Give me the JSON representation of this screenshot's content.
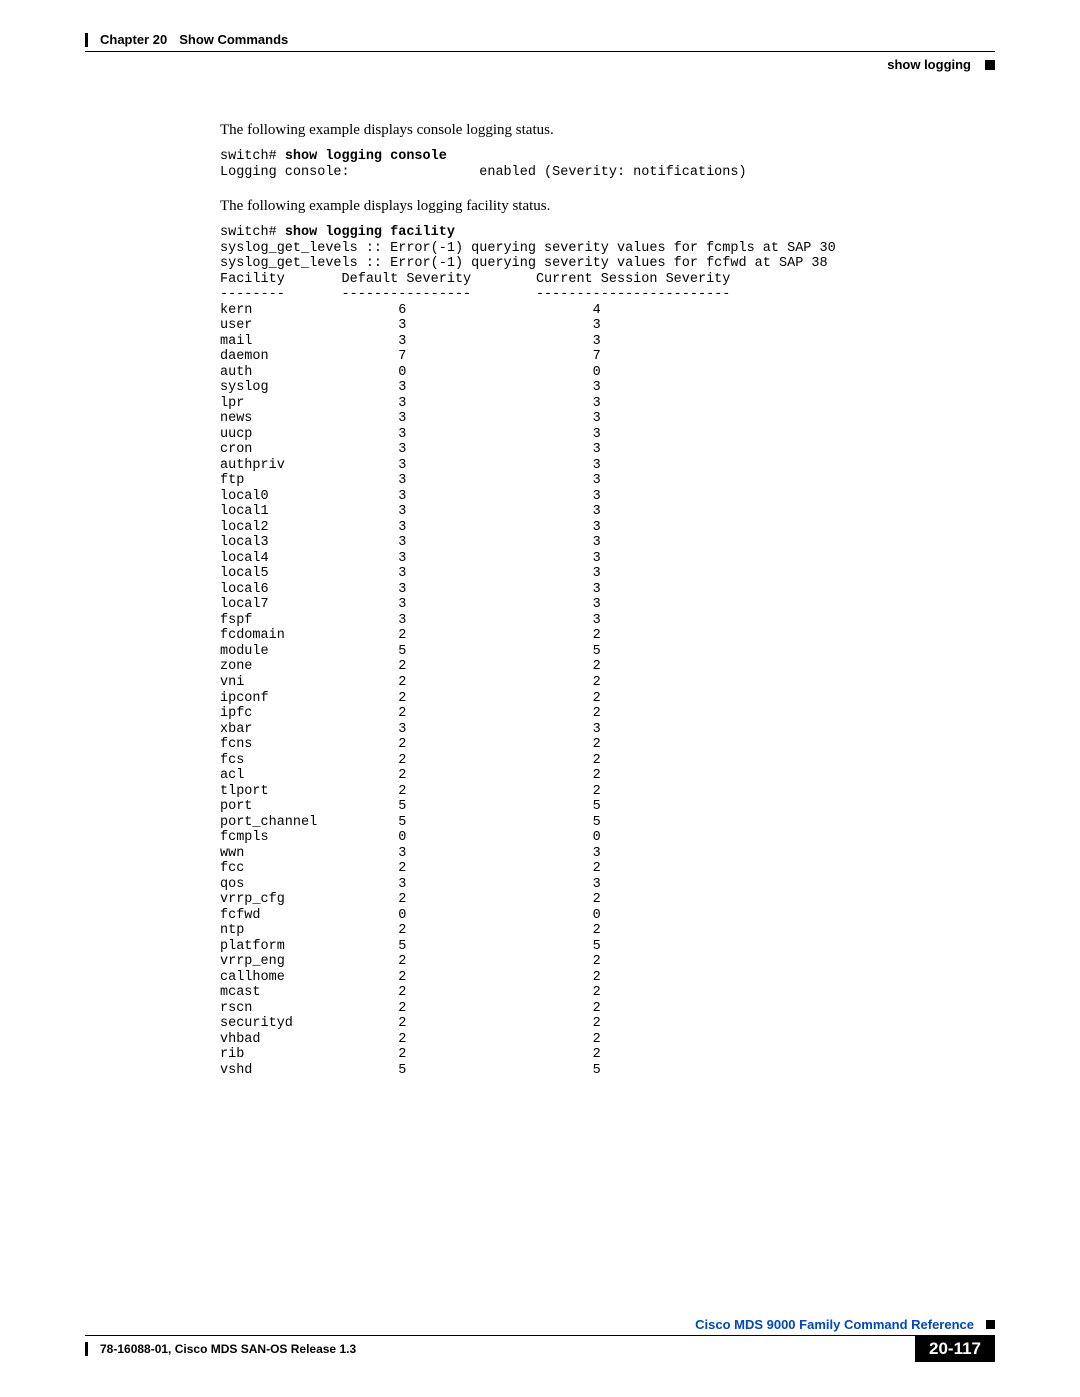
{
  "header": {
    "chapter_label": "Chapter 20",
    "chapter_title": "Show Commands",
    "section": "show logging"
  },
  "content": {
    "intro1": "The following example displays console logging status.",
    "code1_prompt": "switch# ",
    "code1_cmd": "show logging console",
    "code1_output": "Logging console:                enabled (Severity: notifications)",
    "intro2": "The following example displays logging facility status.",
    "code2_prompt": "switch# ",
    "code2_cmd": "show logging facility",
    "code2_syslog1": "syslog_get_levels :: Error(-1) querying severity values for fcmpls at SAP 30",
    "code2_syslog2": "syslog_get_levels :: Error(-1) querying severity values for fcfwd at SAP 38",
    "facility_header": "Facility       Default Severity        Current Session Severity",
    "facility_divider": "--------       ----------------        ------------------------",
    "facilities": [
      {
        "name": "kern",
        "def": "6",
        "cur": "4"
      },
      {
        "name": "user",
        "def": "3",
        "cur": "3"
      },
      {
        "name": "mail",
        "def": "3",
        "cur": "3"
      },
      {
        "name": "daemon",
        "def": "7",
        "cur": "7"
      },
      {
        "name": "auth",
        "def": "0",
        "cur": "0"
      },
      {
        "name": "syslog",
        "def": "3",
        "cur": "3"
      },
      {
        "name": "lpr",
        "def": "3",
        "cur": "3"
      },
      {
        "name": "news",
        "def": "3",
        "cur": "3"
      },
      {
        "name": "uucp",
        "def": "3",
        "cur": "3"
      },
      {
        "name": "cron",
        "def": "3",
        "cur": "3"
      },
      {
        "name": "authpriv",
        "def": "3",
        "cur": "3"
      },
      {
        "name": "ftp",
        "def": "3",
        "cur": "3"
      },
      {
        "name": "local0",
        "def": "3",
        "cur": "3"
      },
      {
        "name": "local1",
        "def": "3",
        "cur": "3"
      },
      {
        "name": "local2",
        "def": "3",
        "cur": "3"
      },
      {
        "name": "local3",
        "def": "3",
        "cur": "3"
      },
      {
        "name": "local4",
        "def": "3",
        "cur": "3"
      },
      {
        "name": "local5",
        "def": "3",
        "cur": "3"
      },
      {
        "name": "local6",
        "def": "3",
        "cur": "3"
      },
      {
        "name": "local7",
        "def": "3",
        "cur": "3"
      },
      {
        "name": "fspf",
        "def": "3",
        "cur": "3"
      },
      {
        "name": "fcdomain",
        "def": "2",
        "cur": "2"
      },
      {
        "name": "module",
        "def": "5",
        "cur": "5"
      },
      {
        "name": "zone",
        "def": "2",
        "cur": "2"
      },
      {
        "name": "vni",
        "def": "2",
        "cur": "2"
      },
      {
        "name": "ipconf",
        "def": "2",
        "cur": "2"
      },
      {
        "name": "ipfc",
        "def": "2",
        "cur": "2"
      },
      {
        "name": "xbar",
        "def": "3",
        "cur": "3"
      },
      {
        "name": "fcns",
        "def": "2",
        "cur": "2"
      },
      {
        "name": "fcs",
        "def": "2",
        "cur": "2"
      },
      {
        "name": "acl",
        "def": "2",
        "cur": "2"
      },
      {
        "name": "tlport",
        "def": "2",
        "cur": "2"
      },
      {
        "name": "port",
        "def": "5",
        "cur": "5"
      },
      {
        "name": "port_channel",
        "def": "5",
        "cur": "5"
      },
      {
        "name": "fcmpls",
        "def": "0",
        "cur": "0"
      },
      {
        "name": "wwn",
        "def": "3",
        "cur": "3"
      },
      {
        "name": "fcc",
        "def": "2",
        "cur": "2"
      },
      {
        "name": "qos",
        "def": "3",
        "cur": "3"
      },
      {
        "name": "vrrp_cfg",
        "def": "2",
        "cur": "2"
      },
      {
        "name": "fcfwd",
        "def": "0",
        "cur": "0"
      },
      {
        "name": "ntp",
        "def": "2",
        "cur": "2"
      },
      {
        "name": "platform",
        "def": "5",
        "cur": "5"
      },
      {
        "name": "vrrp_eng",
        "def": "2",
        "cur": "2"
      },
      {
        "name": "callhome",
        "def": "2",
        "cur": "2"
      },
      {
        "name": "mcast",
        "def": "2",
        "cur": "2"
      },
      {
        "name": "rscn",
        "def": "2",
        "cur": "2"
      },
      {
        "name": "securityd",
        "def": "2",
        "cur": "2"
      },
      {
        "name": "vhbad",
        "def": "2",
        "cur": "2"
      },
      {
        "name": "rib",
        "def": "2",
        "cur": "2"
      },
      {
        "name": "vshd",
        "def": "5",
        "cur": "5"
      }
    ]
  },
  "footer": {
    "reference": "Cisco MDS 9000 Family Command Reference",
    "release": "78-16088-01, Cisco MDS SAN-OS Release 1.3",
    "page": "20-117"
  }
}
